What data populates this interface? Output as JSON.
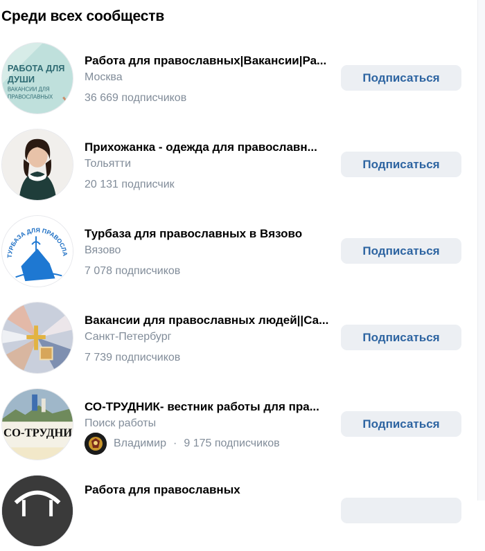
{
  "section": {
    "title": "Среди всех сообществ"
  },
  "communities": [
    {
      "name": "Работа для православных|Вакансии|Ра...",
      "subtitle": "Москва",
      "followers": "36 669 подписчиков",
      "button": "Подписаться",
      "avatar_text": {
        "line1": "РАБОТА ДЛЯ",
        "line2": "ДУШИ",
        "line3": "ВАКАНСИИ ДЛЯ",
        "line4": "ПРАВОСЛАВНЫХ"
      }
    },
    {
      "name": "Прихожанка - одежда для православн...",
      "subtitle": "Тольятти",
      "followers": "20 131 подписчик",
      "button": "Подписаться"
    },
    {
      "name": "Турбаза для православных в Вязово",
      "subtitle": "Вязово",
      "followers": "7 078 подписчиков",
      "button": "Подписаться",
      "avatar_text": {
        "arc": "ТУРБАЗА ДЛЯ ПРАВОСЛАВНЫХ"
      }
    },
    {
      "name": "Вакансии для православных людей||Са...",
      "subtitle": "Санкт-Петербург",
      "followers": "7 739 подписчиков",
      "button": "Подписаться"
    },
    {
      "name": "СО-ТРУДНИК- вестник работы для пра...",
      "subtitle": "Поиск работы",
      "member": "Владимир",
      "member_separator": "·",
      "followers": "9 175 подписчиков",
      "button": "Подписаться",
      "avatar_text": {
        "banner": "СО-ТРУДНИ"
      }
    },
    {
      "name": "Работа для православных"
    }
  ],
  "colors": {
    "button_bg": "#eceff3",
    "button_text": "#2d64a1",
    "secondary_text": "#818c99"
  }
}
